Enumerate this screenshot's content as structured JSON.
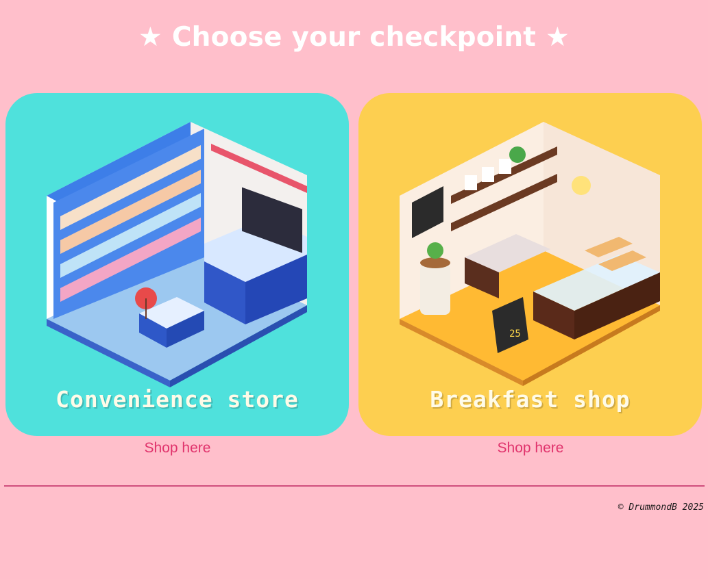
{
  "page": {
    "title": "★ Choose your checkpoint ★",
    "background": "#ffbfcb"
  },
  "cards": [
    {
      "label": "Convenience store",
      "link_text": "Shop here",
      "background": "#4fe1dc",
      "illustration": "pixel-art isometric convenience store room"
    },
    {
      "label": "Breakfast shop",
      "link_text": "Shop here",
      "background": "#fdcf50",
      "illustration": "pixel-art isometric breakfast shop room",
      "sign_text": "25"
    }
  ],
  "footer": {
    "copyright": "© DrummondB 2025"
  },
  "colors": {
    "link": "#e0336c",
    "divider": "#cf4e7d"
  }
}
